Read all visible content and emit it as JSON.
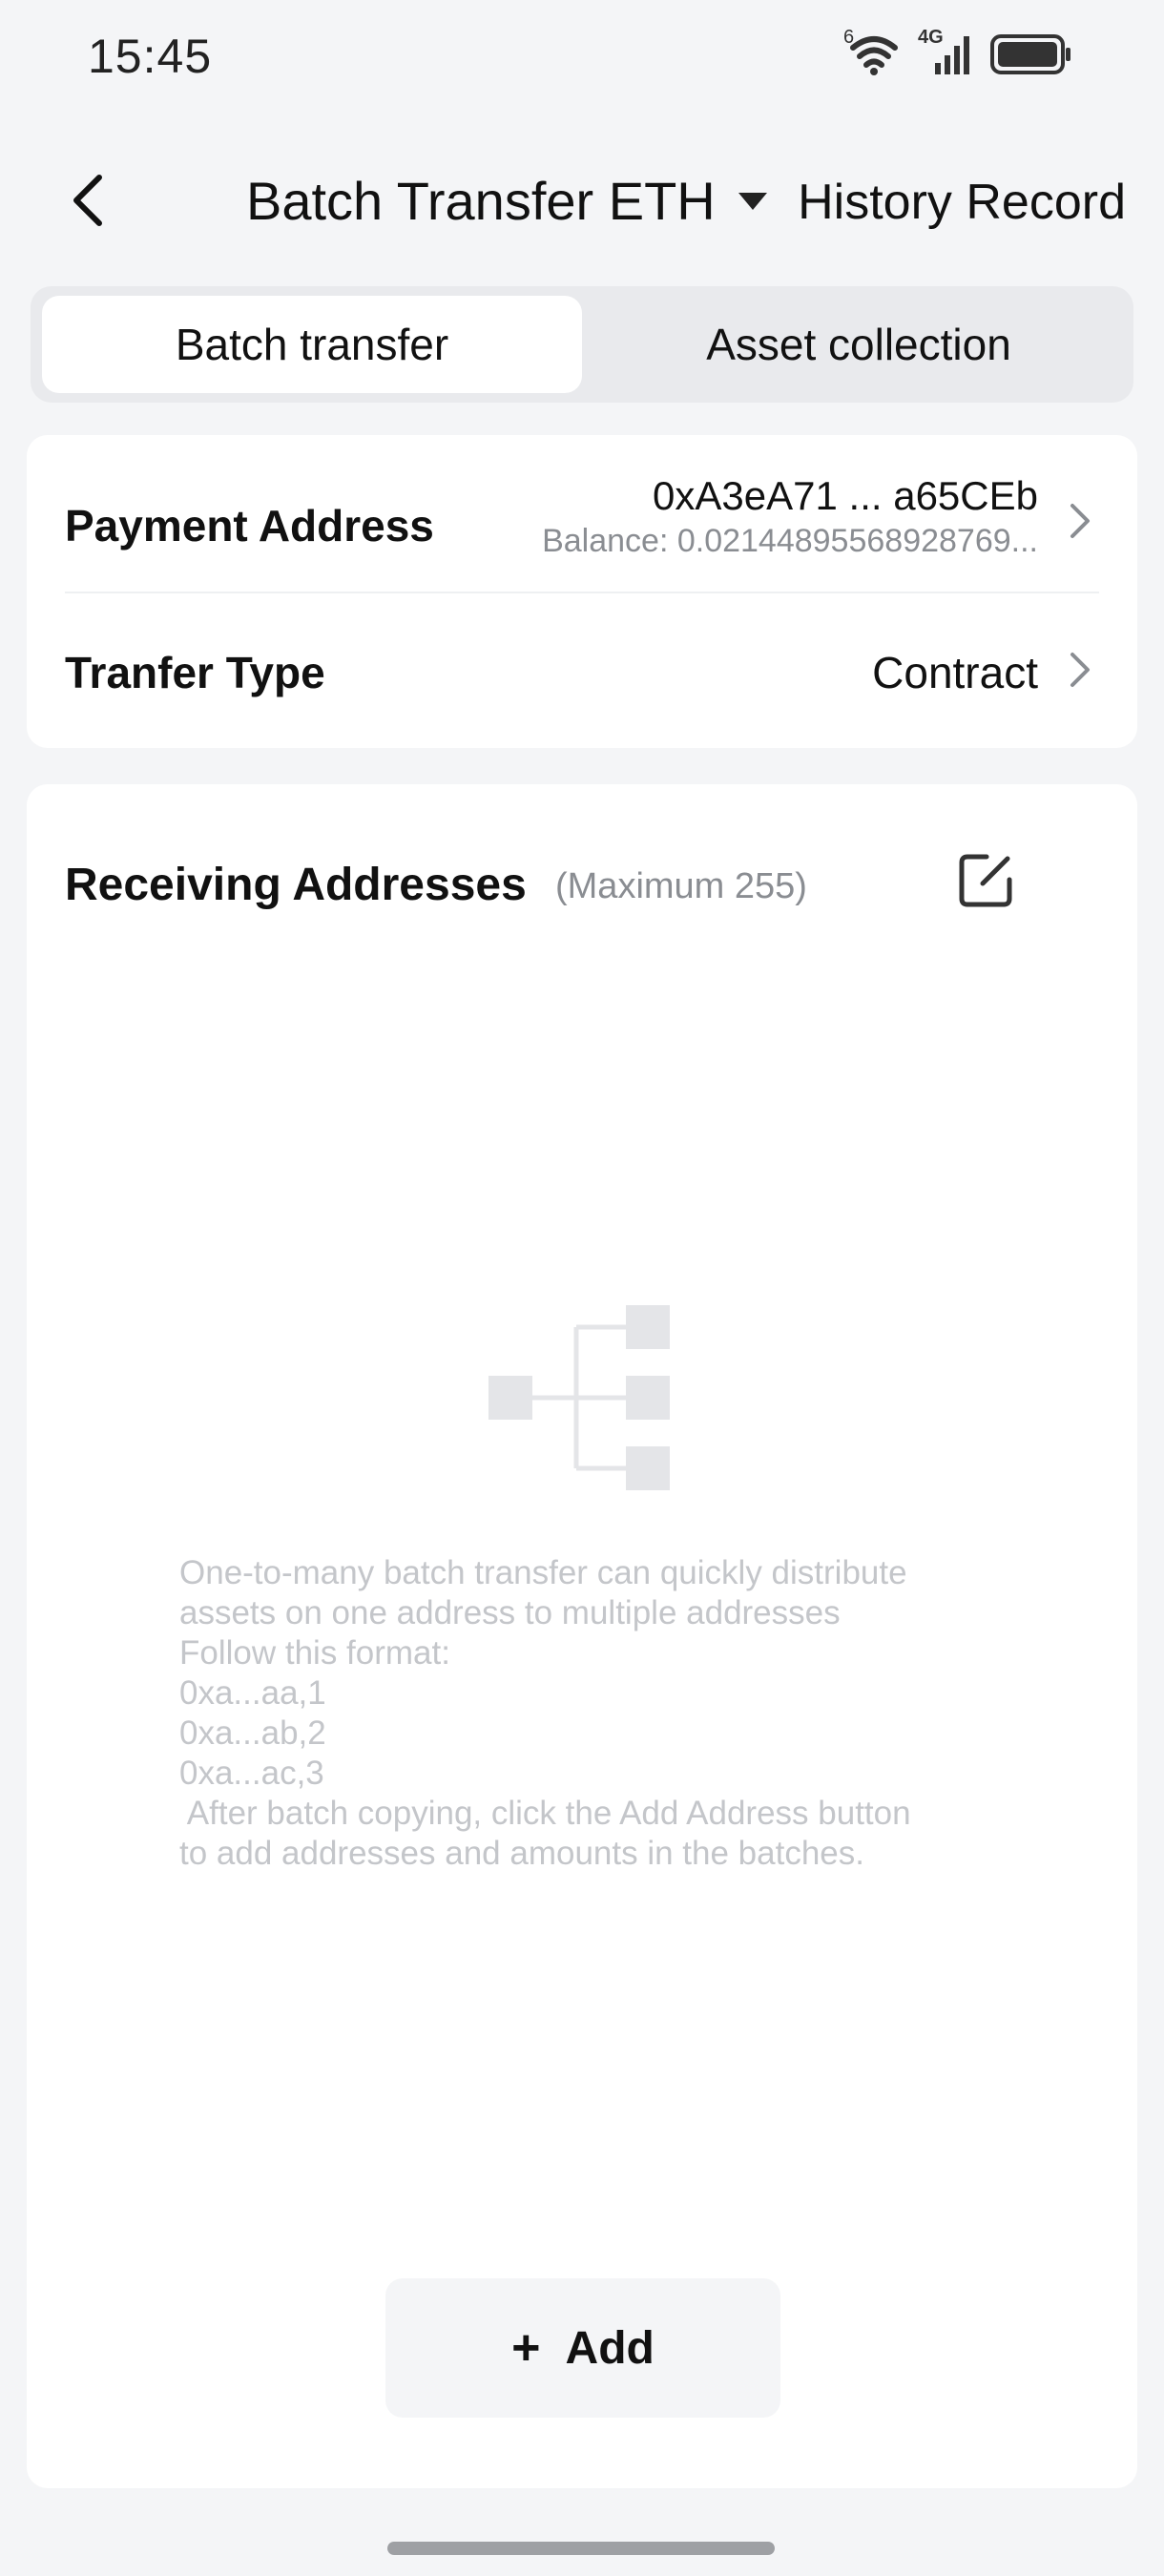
{
  "status_bar": {
    "time": "15:45",
    "wifi_badge": "6",
    "network_label": "4G"
  },
  "header": {
    "title": "Batch Transfer ETH",
    "history_label": "History Record"
  },
  "tabs": [
    {
      "label": "Batch transfer",
      "active": true
    },
    {
      "label": "Asset collection",
      "active": false
    }
  ],
  "payment": {
    "label": "Payment Address",
    "address": "0xA3eA71 ... a65CEb",
    "balance": "Balance: 0.02144895568928769..."
  },
  "transfer_type": {
    "label": "Tranfer Type",
    "value": "Contract"
  },
  "receiving": {
    "title": "Receiving Addresses",
    "maximum": "(Maximum 255)",
    "hint_lines": [
      "One-to-many batch transfer can quickly distribute",
      "assets on one address to multiple addresses",
      "Follow this format:",
      "0xa...aa,1",
      "0xa...ab,2",
      "0xa...ac,3",
      " After batch copying, click the Add Address button",
      "to add addresses and amounts in the batches."
    ],
    "add_icon": "+",
    "add_label": "Add"
  },
  "colors": {
    "background": "#f4f5f7",
    "card": "#ffffff",
    "muted_text": "#8a8d92",
    "hint_text": "#c4c6ca"
  }
}
